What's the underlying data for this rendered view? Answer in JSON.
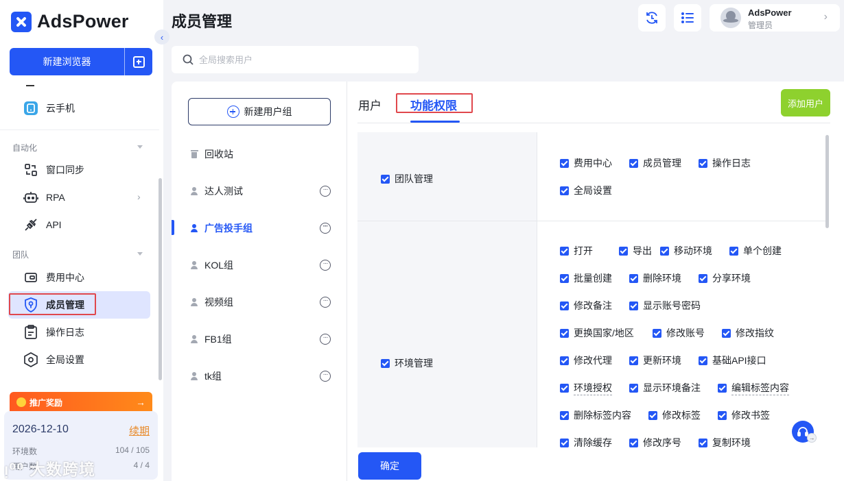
{
  "app": {
    "name": "AdsPower"
  },
  "sidebar": {
    "new_browser_label": "新建浏览器",
    "items_top": [
      {
        "label": "云手机",
        "icon": "cloud-phone-icon"
      }
    ],
    "sections": [
      {
        "title": "自动化",
        "items": [
          {
            "label": "窗口同步",
            "icon": "window-sync-icon"
          },
          {
            "label": "RPA",
            "icon": "robot-icon"
          },
          {
            "label": "API",
            "icon": "plug-icon"
          }
        ]
      },
      {
        "title": "团队",
        "items": [
          {
            "label": "费用中心",
            "icon": "wallet-icon"
          },
          {
            "label": "成员管理",
            "icon": "shield-user-icon",
            "active": true
          },
          {
            "label": "操作日志",
            "icon": "clipboard-icon"
          },
          {
            "label": "全局设置",
            "icon": "settings-hex-icon"
          }
        ]
      }
    ],
    "promo": {
      "label": "推广奖励"
    },
    "plan": {
      "expiry": "2026-12-10",
      "renew_label": "续期",
      "env_label": "环境数",
      "env_value": "104 / 105",
      "user_label": "用户数",
      "user_value": "4 / 4"
    },
    "watermark": "大数跨境"
  },
  "header": {
    "title": "成员管理",
    "user": {
      "name": "AdsPower",
      "role": "管理员"
    }
  },
  "search": {
    "placeholder": "全局搜索用户"
  },
  "groups": {
    "new_group_label": "新建用户组",
    "recycle_label": "回收站",
    "items": [
      {
        "label": "达人测试"
      },
      {
        "label": "广告投手组",
        "active": true
      },
      {
        "label": "KOL组"
      },
      {
        "label": "视频组"
      },
      {
        "label": "FB1组"
      },
      {
        "label": "tk组"
      }
    ]
  },
  "tabs": [
    {
      "label": "用户"
    },
    {
      "label": "功能权限",
      "active": true
    }
  ],
  "add_user_label": "添加用户",
  "permissions": {
    "team": {
      "label": "团队管理",
      "items": [
        "费用中心",
        "成员管理",
        "操作日志",
        "全局设置"
      ]
    },
    "env": {
      "label": "环境管理",
      "items": [
        "打开",
        "导出",
        "移动环境",
        "单个创建",
        "批量创建",
        "删除环境",
        "分享环境",
        "修改备注",
        "显示账号密码",
        "更换国家/地区",
        "修改账号",
        "修改指纹",
        "修改代理",
        "更新环境",
        "基础API接口",
        "环境授权",
        "显示环境备注",
        "编辑标签内容",
        "删除标签内容",
        "修改标签",
        "修改书签",
        "清除缓存",
        "修改序号",
        "复制环境"
      ]
    }
  },
  "confirm_label": "确定",
  "colors": {
    "primary": "#2457f5",
    "success": "#8ed12e",
    "highlight": "#e0474c"
  }
}
